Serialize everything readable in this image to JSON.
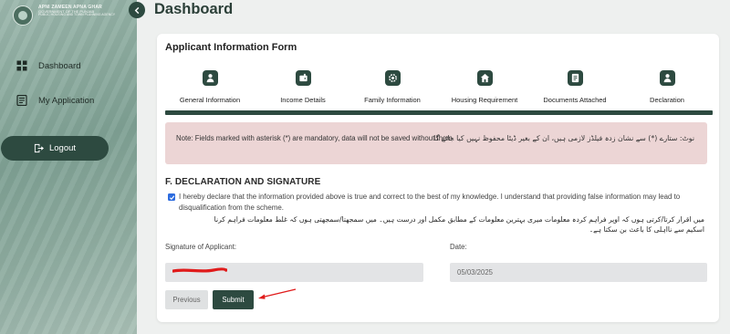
{
  "brand": {
    "line1": "APNI ZAMEEN APNA GHAR",
    "line2": "GOVERNMENT OF THE PUNJAB",
    "line3": "PUBLIC HOUSING AND TOWN PLANNING AGENCY"
  },
  "sidebar": {
    "items": [
      {
        "label": "Dashboard",
        "icon": "dashboard-icon"
      },
      {
        "label": "My Application",
        "icon": "application-icon"
      }
    ],
    "logout_label": "Logout",
    "collapse_icon": "chevron-left-icon"
  },
  "header": {
    "title": "Dashboard"
  },
  "form": {
    "title": "Applicant Information Form",
    "steps": [
      {
        "label": "General Information",
        "icon": "user-icon"
      },
      {
        "label": "Income Details",
        "icon": "wallet-icon"
      },
      {
        "label": "Family Information",
        "icon": "family-icon"
      },
      {
        "label": "Housing Requirement",
        "icon": "home-icon"
      },
      {
        "label": "Documents Attached",
        "icon": "document-icon"
      },
      {
        "label": "Declaration",
        "icon": "user-icon"
      }
    ],
    "progress_fraction": 1.0,
    "note_en": "Note: Fields marked with asterisk (*) are mandatory, data will not be saved without them.",
    "note_ur": "نوٹ: ستارے (*) سے نشان زدہ فیلڈز لازمی ہیں، ان کے بغیر ڈیٹا محفوظ نہیں کیا جائے گا",
    "section_title": "F. DECLARATION AND SIGNATURE",
    "declaration_checked": true,
    "declaration_en": "I hereby declare that the information provided above is true and correct to the best of my knowledge. I understand that providing false information may lead to disqualification from the scheme.",
    "declaration_ur": "میں اقرار کرتا/کرتی ہوں کہ اوپر فراہم کردہ معلومات میری بہترین معلومات کے مطابق مکمل اور درست ہیں۔ میں سمجھتا/سمجھتی ہوں کہ غلط معلومات فراہم کرنا اسکیم سے نااہلی کا باعث بن سکتا ہے۔",
    "signature_label": "Signature of Applicant:",
    "date_label": "Date:",
    "date_value": "05/03/2025",
    "previous_label": "Previous",
    "submit_label": "Submit"
  },
  "colors": {
    "primary": "#2d4a40",
    "note_bg": "#ecd5d5",
    "checkbox": "#2d6cdf",
    "annotation": "#e01b1b"
  }
}
